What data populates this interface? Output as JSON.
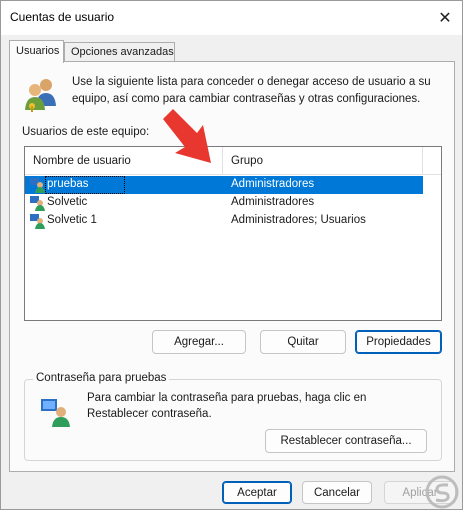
{
  "window": {
    "title": "Cuentas de usuario",
    "close_glyph": "✕"
  },
  "tabs": [
    {
      "label": "Usuarios",
      "active": true
    },
    {
      "label": "Opciones avanzadas",
      "active": false
    }
  ],
  "intro_text": "Use la siguiente lista para conceder o denegar acceso de usuario a su equipo, así como para cambiar contraseñas y otras configuraciones.",
  "users_list": {
    "caption": "Usuarios de este equipo:",
    "columns": [
      "Nombre de usuario",
      "Grupo"
    ],
    "rows": [
      {
        "name": "pruebas",
        "group": "Administradores",
        "selected": true
      },
      {
        "name": "Solvetic",
        "group": "Administradores",
        "selected": false
      },
      {
        "name": "Solvetic 1",
        "group": "Administradores; Usuarios",
        "selected": false
      }
    ]
  },
  "list_buttons": {
    "add": "Agregar...",
    "remove": "Quitar",
    "properties": "Propiedades"
  },
  "password_group": {
    "legend": "Contraseña para pruebas",
    "text": "Para cambiar la contraseña para pruebas, haga clic en Restablecer contraseña.",
    "reset_button": "Restablecer contraseña..."
  },
  "footer_buttons": {
    "ok": "Aceptar",
    "cancel": "Cancelar",
    "apply": "Aplicar"
  },
  "colors": {
    "selection": "#0078d7",
    "annotation_arrow": "#e8372f",
    "default_button_border": "#005fb8"
  },
  "icons": [
    "users-icon",
    "user-row-icon",
    "key-user-icon",
    "close-icon",
    "red-arrow-annotation",
    "solvetic-watermark"
  ]
}
